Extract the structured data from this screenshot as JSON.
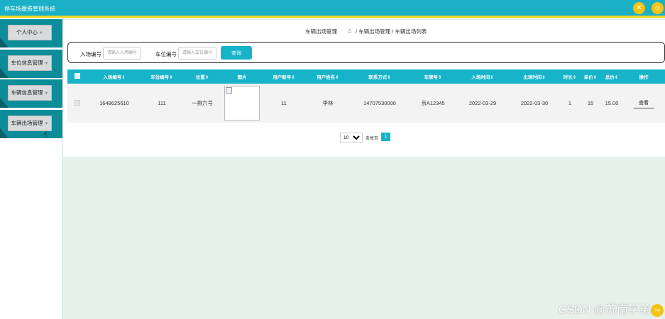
{
  "app": {
    "title": "停车场缴费管理系统"
  },
  "header_icons": [
    "settings-icon",
    "user-icon"
  ],
  "sidebar": {
    "items": [
      {
        "label": "个人中心"
      },
      {
        "label": "车位信息管理"
      },
      {
        "label": "车辆信息管理"
      },
      {
        "label": "车辆出场管理"
      }
    ]
  },
  "breadcrumb": {
    "section": "车辆出场管理",
    "path": "/ 车辆出场管理 / 车辆出场列表"
  },
  "search": {
    "entry_no_label": "入场编号",
    "entry_no_placeholder": "请输入入场编号",
    "space_no_label": "车位编号",
    "space_no_placeholder": "请输入车位编号",
    "query_button": "查询"
  },
  "table": {
    "headers": [
      "入场编号",
      "车位编号",
      "位置",
      "图片",
      "用户账号",
      "用户姓名",
      "联系方式",
      "车牌号",
      "入场时间",
      "出场时间",
      "时长",
      "单价",
      "总价",
      "操作"
    ],
    "rows": [
      {
        "entry_no": "1648625610",
        "space_no": "111",
        "location": "一排六号",
        "account": "11",
        "name": "李林",
        "phone": "14707530000",
        "plate": "京A12345",
        "entry_time": "2022-03-29",
        "exit_time": "2022-03-30",
        "duration": "1",
        "unit_price": "15",
        "total": "15.00",
        "action": "查看"
      }
    ]
  },
  "pagination": {
    "page_size": "10",
    "per_page_label": "条每页",
    "current_page": "1"
  },
  "watermark": "CSDN @苏南学弟",
  "back_to_top": "Top",
  "colors": {
    "primary": "#17b3c9",
    "accent": "#f5c413",
    "sidebar_block": "#0d8d9a",
    "background": "#e6f1ec"
  }
}
